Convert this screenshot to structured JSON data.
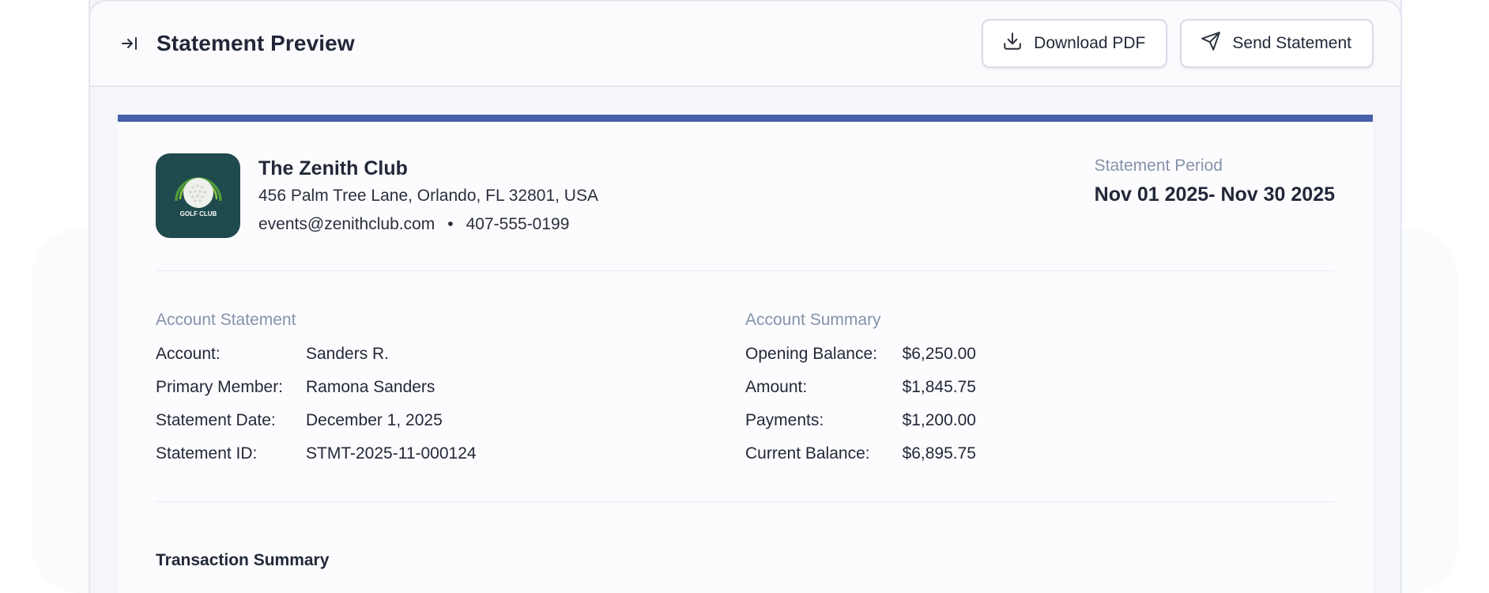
{
  "header": {
    "title": "Statement Preview",
    "download_label": "Download PDF",
    "send_label": "Send Statement"
  },
  "club": {
    "name": "The Zenith Club",
    "address": "456 Palm Tree Lane, Orlando, FL 32801, USA",
    "email": "events@zenithclub.com",
    "separator": "•",
    "phone": "407-555-0199",
    "logo_text": "GOLF CLUB"
  },
  "period": {
    "label": "Statement Period",
    "value": "Nov 01 2025- Nov 30 2025"
  },
  "account_statement": {
    "title": "Account Statement",
    "rows": [
      {
        "label": "Account:",
        "value": "Sanders R."
      },
      {
        "label": "Primary Member:",
        "value": "Ramona Sanders"
      },
      {
        "label": "Statement Date:",
        "value": "December 1, 2025"
      },
      {
        "label": "Statement ID:",
        "value": "STMT-2025-11-000124"
      }
    ]
  },
  "account_summary": {
    "title": "Account Summary",
    "rows": [
      {
        "label": "Opening Balance:",
        "value": "$6,250.00"
      },
      {
        "label": "Amount:",
        "value": "$1,845.75"
      },
      {
        "label": "Payments:",
        "value": "$1,200.00"
      },
      {
        "label": "Current Balance:",
        "value": "$6,895.75"
      }
    ]
  },
  "transactions": {
    "title": "Transaction Summary"
  },
  "colors": {
    "accent": "#4660a9",
    "logo_bg": "#1f4a4e",
    "muted_label": "#8592aa"
  },
  "icons": {
    "collapse": "arrow-right-to-bar-icon",
    "download": "download-icon",
    "send": "send-icon",
    "logo": "golf-ball-logo-icon"
  }
}
